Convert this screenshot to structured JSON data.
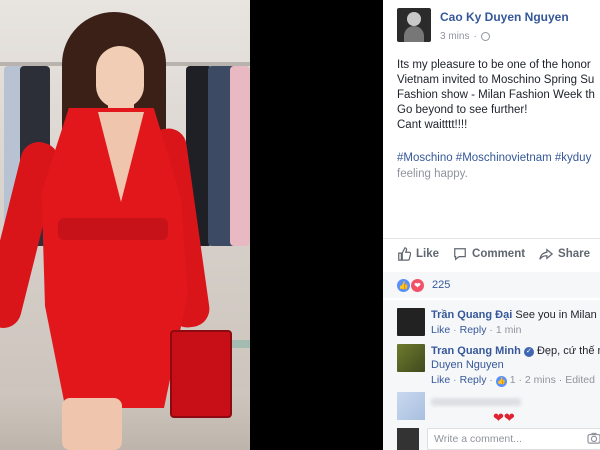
{
  "post": {
    "author": "Cao Ky Duyen Nguyen",
    "time": "3 mins",
    "body_lines": [
      "Its my pleasure to be one of the honor",
      "Vietnam invited to Moschino Spring Su",
      "Fashion show - Milan Fashion Week th",
      "Go beyond to see further!",
      "Cant waitttt!!!!"
    ],
    "hashtags": "#Moschino #Moschinovietnam #kyduy",
    "feeling": "feeling happy."
  },
  "actions": {
    "like": "Like",
    "comment": "Comment",
    "share": "Share"
  },
  "reactions": {
    "count": "225"
  },
  "comments": [
    {
      "name": "Trần Quang Đại",
      "text": "See you in Milan nha",
      "like": "Like",
      "reply": "Reply",
      "time": "1 min"
    },
    {
      "name": "Tran Quang Minh",
      "text": "Đẹp, cứ thế nhe",
      "mention": "Duyen Nguyen",
      "like": "Like",
      "reply": "Reply",
      "likes": "1",
      "time": "2 mins",
      "edited": "Edited"
    }
  ],
  "compose": {
    "placeholder": "Write a comment..."
  },
  "colors": {
    "link": "#365899",
    "dress": "#e2171b"
  }
}
